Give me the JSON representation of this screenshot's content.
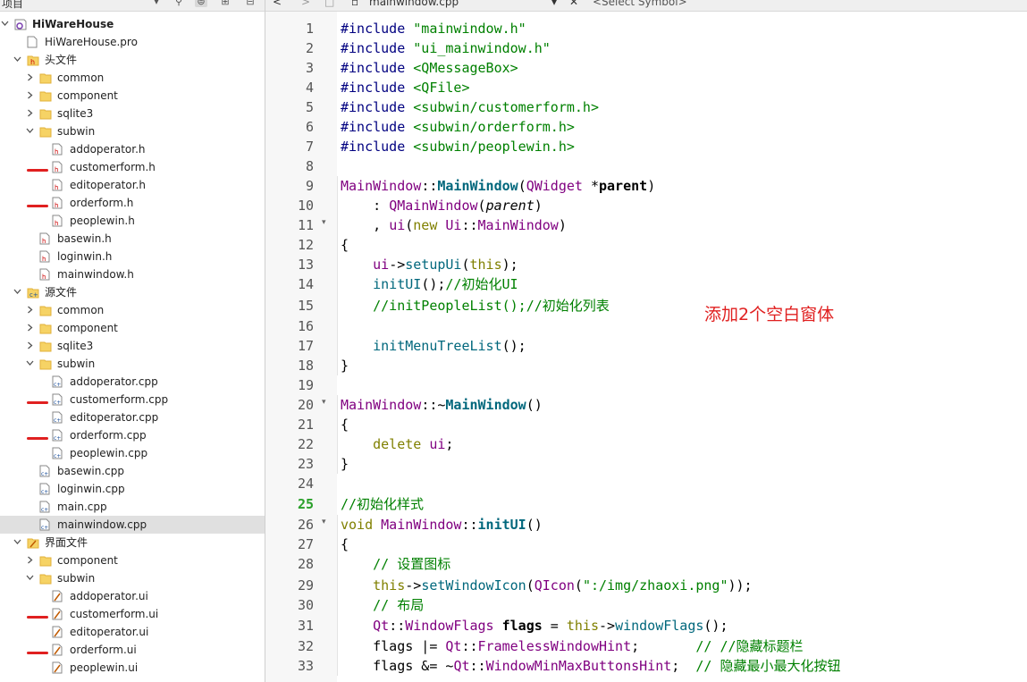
{
  "project_panel": {
    "title": "项目",
    "items": [
      {
        "label": "HiWareHouse",
        "level": 0,
        "expanded": true,
        "icon": "project-icon",
        "bold": true
      },
      {
        "label": "HiWareHouse.pro",
        "level": 1,
        "icon": "pro-file-icon"
      },
      {
        "label": "头文件",
        "level": 1,
        "expanded": true,
        "icon": "headers-folder-icon"
      },
      {
        "label": "common",
        "level": 2,
        "expanded": false,
        "icon": "folder-icon"
      },
      {
        "label": "component",
        "level": 2,
        "expanded": false,
        "icon": "folder-icon"
      },
      {
        "label": "sqlite3",
        "level": 2,
        "expanded": false,
        "icon": "folder-icon"
      },
      {
        "label": "subwin",
        "level": 2,
        "expanded": true,
        "icon": "folder-icon"
      },
      {
        "label": "addoperator.h",
        "level": 3,
        "icon": "header-file-icon"
      },
      {
        "label": "customerform.h",
        "level": 3,
        "icon": "header-file-icon",
        "marked": true
      },
      {
        "label": "editoperator.h",
        "level": 3,
        "icon": "header-file-icon"
      },
      {
        "label": "orderform.h",
        "level": 3,
        "icon": "header-file-icon",
        "marked": true
      },
      {
        "label": "peoplewin.h",
        "level": 3,
        "icon": "header-file-icon"
      },
      {
        "label": "basewin.h",
        "level": 2,
        "icon": "header-file-icon"
      },
      {
        "label": "loginwin.h",
        "level": 2,
        "icon": "header-file-icon"
      },
      {
        "label": "mainwindow.h",
        "level": 2,
        "icon": "header-file-icon"
      },
      {
        "label": "源文件",
        "level": 1,
        "expanded": true,
        "icon": "sources-folder-icon"
      },
      {
        "label": "common",
        "level": 2,
        "expanded": false,
        "icon": "folder-icon"
      },
      {
        "label": "component",
        "level": 2,
        "expanded": false,
        "icon": "folder-icon"
      },
      {
        "label": "sqlite3",
        "level": 2,
        "expanded": false,
        "icon": "folder-icon"
      },
      {
        "label": "subwin",
        "level": 2,
        "expanded": true,
        "icon": "folder-icon"
      },
      {
        "label": "addoperator.cpp",
        "level": 3,
        "icon": "cpp-file-icon"
      },
      {
        "label": "customerform.cpp",
        "level": 3,
        "icon": "cpp-file-icon",
        "marked": true
      },
      {
        "label": "editoperator.cpp",
        "level": 3,
        "icon": "cpp-file-icon"
      },
      {
        "label": "orderform.cpp",
        "level": 3,
        "icon": "cpp-file-icon",
        "marked": true
      },
      {
        "label": "peoplewin.cpp",
        "level": 3,
        "icon": "cpp-file-icon"
      },
      {
        "label": "basewin.cpp",
        "level": 2,
        "icon": "cpp-file-icon"
      },
      {
        "label": "loginwin.cpp",
        "level": 2,
        "icon": "cpp-file-icon"
      },
      {
        "label": "main.cpp",
        "level": 2,
        "icon": "cpp-file-icon"
      },
      {
        "label": "mainwindow.cpp",
        "level": 2,
        "icon": "cpp-file-icon",
        "selected": true
      },
      {
        "label": "界面文件",
        "level": 1,
        "expanded": true,
        "icon": "forms-folder-icon"
      },
      {
        "label": "component",
        "level": 2,
        "expanded": false,
        "icon": "folder-icon"
      },
      {
        "label": "subwin",
        "level": 2,
        "expanded": true,
        "icon": "folder-icon"
      },
      {
        "label": "addoperator.ui",
        "level": 3,
        "icon": "ui-file-icon"
      },
      {
        "label": "customerform.ui",
        "level": 3,
        "icon": "ui-file-icon",
        "marked": true
      },
      {
        "label": "editoperator.ui",
        "level": 3,
        "icon": "ui-file-icon"
      },
      {
        "label": "orderform.ui",
        "level": 3,
        "icon": "ui-file-icon",
        "marked": true
      },
      {
        "label": "peoplewin.ui",
        "level": 3,
        "icon": "ui-file-icon"
      }
    ]
  },
  "editor_header": {
    "file_name": "mainwindow.cpp",
    "symbol_placeholder": "<Select Symbol>"
  },
  "editor": {
    "current_line": 25,
    "lines": [
      {
        "n": "1",
        "tokens": [
          [
            "pp",
            "#include "
          ],
          [
            "str",
            "\"mainwindow.h\""
          ]
        ]
      },
      {
        "n": "2",
        "tokens": [
          [
            "pp",
            "#include "
          ],
          [
            "str",
            "\"ui_mainwindow.h\""
          ]
        ]
      },
      {
        "n": "3",
        "tokens": [
          [
            "pp",
            "#include "
          ],
          [
            "str",
            "<QMessageBox>"
          ]
        ]
      },
      {
        "n": "4",
        "tokens": [
          [
            "pp",
            "#include "
          ],
          [
            "str",
            "<QFile>"
          ]
        ]
      },
      {
        "n": "5",
        "tokens": [
          [
            "pp",
            "#include "
          ],
          [
            "str",
            "<subwin/customerform.h>"
          ]
        ]
      },
      {
        "n": "6",
        "tokens": [
          [
            "pp",
            "#include "
          ],
          [
            "str",
            "<subwin/orderform.h>"
          ]
        ]
      },
      {
        "n": "7",
        "tokens": [
          [
            "pp",
            "#include "
          ],
          [
            "str",
            "<subwin/peoplewin.h>"
          ]
        ]
      },
      {
        "n": "8",
        "tokens": []
      },
      {
        "n": "9",
        "tokens": [
          [
            "cls",
            "MainWindow"
          ],
          [
            "",
            "::"
          ],
          [
            "fnb",
            "MainWindow"
          ],
          [
            "",
            "("
          ],
          [
            "cls",
            "QWidget"
          ],
          [
            "",
            " *"
          ],
          [
            "bold",
            "parent"
          ],
          [
            "",
            ")"
          ]
        ]
      },
      {
        "n": "10",
        "tokens": [
          [
            "",
            "    : "
          ],
          [
            "cls",
            "QMainWindow"
          ],
          [
            "",
            "("
          ],
          [
            "it",
            "parent"
          ],
          [
            "",
            ")"
          ]
        ]
      },
      {
        "n": "11",
        "fold": true,
        "tokens": [
          [
            "",
            "    , "
          ],
          [
            "cls",
            "ui"
          ],
          [
            "",
            "("
          ],
          [
            "kw",
            "new"
          ],
          [
            "",
            " "
          ],
          [
            "cls",
            "Ui"
          ],
          [
            "",
            "::"
          ],
          [
            "cls",
            "MainWindow"
          ],
          [
            "",
            ")"
          ]
        ]
      },
      {
        "n": "12",
        "tokens": [
          [
            "",
            "{"
          ]
        ]
      },
      {
        "n": "13",
        "tokens": [
          [
            "",
            "    "
          ],
          [
            "cls",
            "ui"
          ],
          [
            "",
            "->"
          ],
          [
            "fn",
            "setupUi"
          ],
          [
            "",
            "("
          ],
          [
            "kw",
            "this"
          ],
          [
            "",
            ");"
          ]
        ]
      },
      {
        "n": "14",
        "tokens": [
          [
            "",
            "    "
          ],
          [
            "fn",
            "initUI"
          ],
          [
            "",
            "();"
          ],
          [
            "cm",
            "//初始化UI"
          ]
        ]
      },
      {
        "n": "15",
        "tokens": [
          [
            "",
            "    "
          ],
          [
            "cm",
            "//initPeopleList();//初始化列表"
          ]
        ]
      },
      {
        "n": "16",
        "tokens": []
      },
      {
        "n": "17",
        "tokens": [
          [
            "",
            "    "
          ],
          [
            "fn",
            "initMenuTreeList"
          ],
          [
            "",
            "();"
          ]
        ]
      },
      {
        "n": "18",
        "tokens": [
          [
            "",
            "}"
          ]
        ]
      },
      {
        "n": "19",
        "tokens": []
      },
      {
        "n": "20",
        "fold": true,
        "tokens": [
          [
            "cls",
            "MainWindow"
          ],
          [
            "",
            "::~"
          ],
          [
            "fnb",
            "MainWindow"
          ],
          [
            "",
            "()"
          ]
        ]
      },
      {
        "n": "21",
        "tokens": [
          [
            "",
            "{"
          ]
        ]
      },
      {
        "n": "22",
        "tokens": [
          [
            "",
            "    "
          ],
          [
            "kw",
            "delete"
          ],
          [
            "",
            " "
          ],
          [
            "cls",
            "ui"
          ],
          [
            "",
            ";"
          ]
        ]
      },
      {
        "n": "23",
        "tokens": [
          [
            "",
            "}"
          ]
        ]
      },
      {
        "n": "24",
        "tokens": []
      },
      {
        "n": "25",
        "tokens": [
          [
            "cm",
            "//初始化样式"
          ]
        ]
      },
      {
        "n": "26",
        "fold": true,
        "tokens": [
          [
            "kw",
            "void"
          ],
          [
            "",
            " "
          ],
          [
            "cls",
            "MainWindow"
          ],
          [
            "",
            "::"
          ],
          [
            "fnb",
            "initUI"
          ],
          [
            "",
            "()"
          ]
        ]
      },
      {
        "n": "27",
        "tokens": [
          [
            "",
            "{"
          ]
        ]
      },
      {
        "n": "28",
        "tokens": [
          [
            "",
            "    "
          ],
          [
            "cm",
            "// 设置图标"
          ]
        ]
      },
      {
        "n": "29",
        "tokens": [
          [
            "",
            "    "
          ],
          [
            "kw",
            "this"
          ],
          [
            "",
            "->"
          ],
          [
            "fn",
            "setWindowIcon"
          ],
          [
            "",
            "("
          ],
          [
            "cls",
            "QIcon"
          ],
          [
            "",
            "("
          ],
          [
            "str",
            "\":/img/zhaoxi.png\""
          ],
          [
            "",
            "));"
          ]
        ]
      },
      {
        "n": "30",
        "tokens": [
          [
            "",
            "    "
          ],
          [
            "cm",
            "// 布局"
          ]
        ]
      },
      {
        "n": "31",
        "tokens": [
          [
            "",
            "    "
          ],
          [
            "cls",
            "Qt"
          ],
          [
            "",
            "::"
          ],
          [
            "cls",
            "WindowFlags"
          ],
          [
            "",
            " "
          ],
          [
            "bold",
            "flags"
          ],
          [
            "",
            " = "
          ],
          [
            "kw",
            "this"
          ],
          [
            "",
            "->"
          ],
          [
            "fn",
            "windowFlags"
          ],
          [
            "",
            "();"
          ]
        ]
      },
      {
        "n": "32",
        "tokens": [
          [
            "",
            "    flags |= "
          ],
          [
            "cls",
            "Qt"
          ],
          [
            "",
            "::"
          ],
          [
            "enum",
            "FramelessWindowHint"
          ],
          [
            "",
            ";       "
          ],
          [
            "cm",
            "// //隐藏标题栏"
          ]
        ]
      },
      {
        "n": "33",
        "tokens": [
          [
            "",
            "    flags &= ~"
          ],
          [
            "cls",
            "Qt"
          ],
          [
            "",
            "::"
          ],
          [
            "enum",
            "WindowMinMaxButtonsHint"
          ],
          [
            "",
            ";  "
          ],
          [
            "cm",
            "// 隐藏最小最大化按钮"
          ]
        ]
      }
    ]
  },
  "annotation": {
    "text": "添加2个空白窗体",
    "color": "#e02020"
  }
}
